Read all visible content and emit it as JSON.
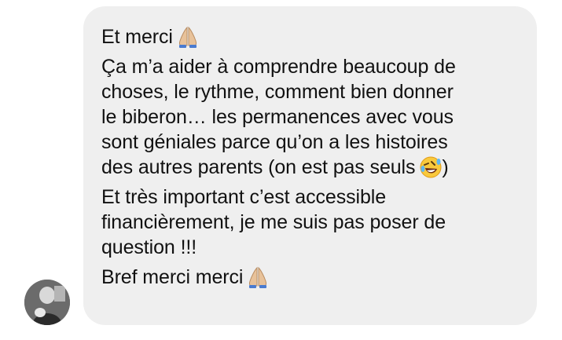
{
  "message": {
    "paragraphs": [
      {
        "lines": [
          {
            "text": "Et merci",
            "emoji": "folded-hands-icon"
          }
        ]
      },
      {
        "lines": [
          {
            "text": "Ça m’a aider à comprendre beaucoup de"
          },
          {
            "text": "choses, le rythme, comment bien donner"
          },
          {
            "text": "le biberon… les permanences avec vous"
          },
          {
            "text": "sont géniales parce qu’on a les histoires"
          },
          {
            "text": "des autres parents (on est pas seuls",
            "emoji": "rolling-laughing-icon",
            "suffix": ")"
          }
        ]
      },
      {
        "lines": [
          {
            "text": "Et très important c’est accessible"
          },
          {
            "text": "financièrement, je me suis pas poser de"
          },
          {
            "text": "question !!!"
          }
        ]
      },
      {
        "lines": [
          {
            "text": "Bref merci merci",
            "emoji": "folded-hands-icon"
          }
        ]
      }
    ]
  },
  "colors": {
    "bubble_background": "#efefef",
    "text": "#111111"
  }
}
